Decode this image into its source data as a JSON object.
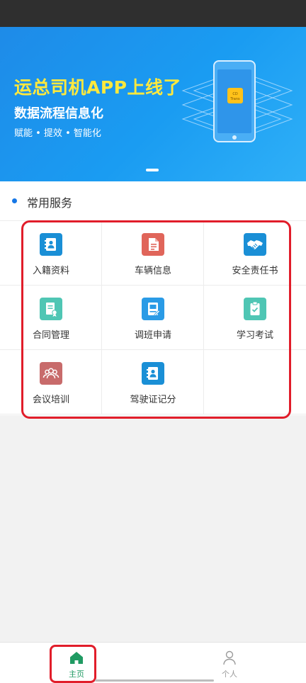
{
  "banner": {
    "title": "运总司机APP上线了",
    "subtitle": "数据流程信息化",
    "tagline": "赋能 • 提效 • 智能化",
    "phone_badge": "CD\nTrans",
    "title_color": "#ffe93d",
    "background_color": "#1e8be8"
  },
  "services": {
    "section_title": "常用服务",
    "items": [
      {
        "label": "入籍资料",
        "icon": "address-book-icon",
        "color": "#1a8fd6"
      },
      {
        "label": "车辆信息",
        "icon": "document-icon",
        "color": "#e0655a"
      },
      {
        "label": "安全责任书",
        "icon": "handshake-icon",
        "color": "#1a8fd6"
      },
      {
        "label": "合同管理",
        "icon": "contract-icon",
        "color": "#4fc6b4"
      },
      {
        "label": "调班申请",
        "icon": "leave-request-icon",
        "color": "#2a9be6"
      },
      {
        "label": "学习考试",
        "icon": "clipboard-check-icon",
        "color": "#4fc6b4"
      },
      {
        "label": "会议培训",
        "icon": "users-icon",
        "color": "#c86b6b"
      },
      {
        "label": "驾驶证记分",
        "icon": "address-book-icon",
        "color": "#1a8fd6"
      }
    ]
  },
  "tabbar": {
    "tabs": [
      {
        "label": "主页",
        "icon": "home-icon",
        "active": true,
        "color": "#1f9a62"
      },
      {
        "label": "个人",
        "icon": "person-icon",
        "active": false,
        "color": "#9a9a9a"
      }
    ]
  },
  "colors": {
    "accent": "#1677e6",
    "highlight": "#e11d2a"
  }
}
